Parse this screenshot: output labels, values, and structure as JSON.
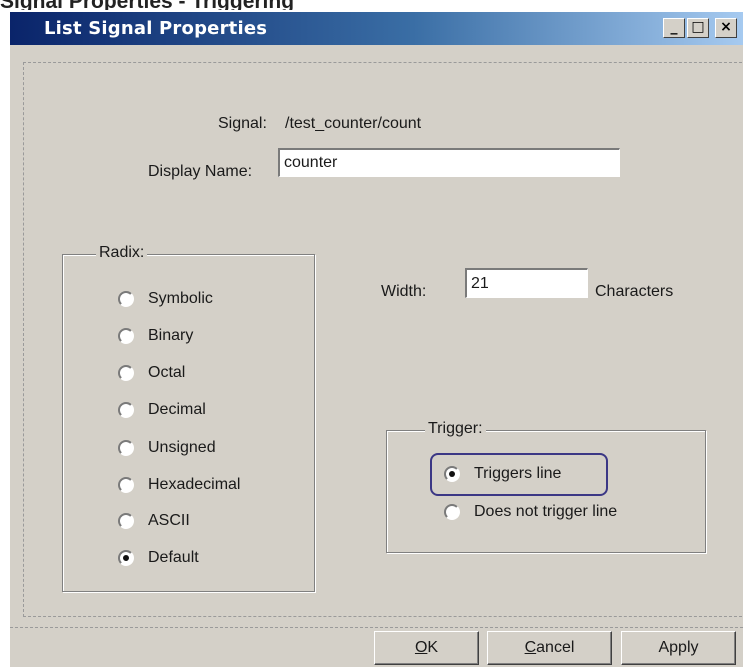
{
  "caption": "Signal Properties - Triggering",
  "window": {
    "title": "List Signal Properties",
    "controls": {
      "minimize": "_",
      "maximize": "□",
      "close": "×"
    }
  },
  "signal": {
    "label": "Signal:",
    "value": "/test_counter/count"
  },
  "display_name": {
    "label": "Display Name:",
    "value": "counter"
  },
  "radix": {
    "legend": "Radix:",
    "selected": "Default",
    "options": [
      "Symbolic",
      "Binary",
      "Octal",
      "Decimal",
      "Unsigned",
      "Hexadecimal",
      "ASCII",
      "Default"
    ]
  },
  "width": {
    "label": "Width:",
    "value": "21",
    "suffix": "Characters"
  },
  "trigger": {
    "legend": "Trigger:",
    "selected": "Triggers line",
    "options": [
      "Triggers line",
      "Does not trigger line"
    ]
  },
  "buttons": {
    "ok": {
      "accel": "O",
      "rest": "K"
    },
    "cancel": {
      "accel": "C",
      "rest": "ancel"
    },
    "apply": {
      "accel": "",
      "rest": "Apply"
    }
  },
  "colors": {
    "highlight": "#3b3785",
    "title_start": "#0a246a",
    "title_end": "#a6caf0"
  }
}
